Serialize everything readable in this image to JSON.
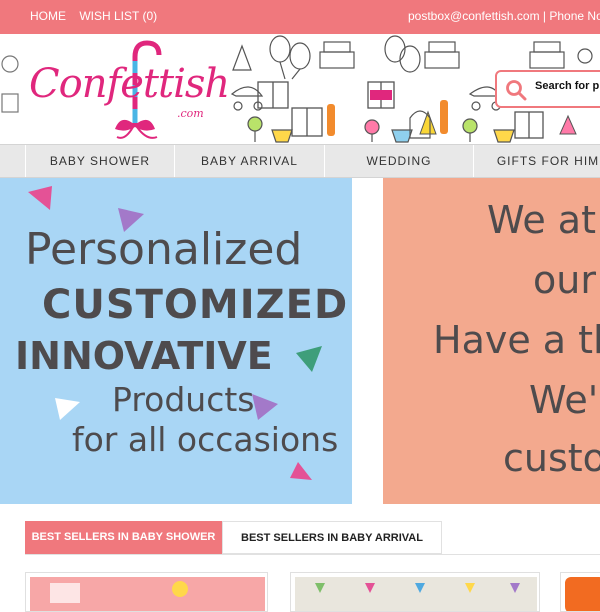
{
  "topbar": {
    "home": "HOME",
    "wishlist": "WISH LIST (0)",
    "contact": "postbox@confettish.com | Phone No"
  },
  "logo": {
    "word": "Confettish",
    "domain": ".com"
  },
  "search": {
    "placeholder": "Search for p"
  },
  "nav": {
    "items": [
      "BABY SHOWER",
      "BABY ARRIVAL",
      "WEDDING",
      "GIFTS FOR HIM"
    ]
  },
  "banner_left": {
    "lines": [
      "Personalized",
      "CUSTOMIZED",
      "INNOVATIVE",
      "Products",
      "for all occasions"
    ]
  },
  "banner_right": {
    "lines": [
      "We at Co",
      "our c",
      "Have a ther",
      "We'll",
      "custom"
    ]
  },
  "tabs": {
    "active": "BEST SELLERS IN BABY SHOWER",
    "inactive": "BEST SELLERS IN BABY ARRIVAL"
  },
  "colors": {
    "accent": "#f0787d",
    "nav_bg": "#e8e8e8",
    "banner_blue": "#a9d6f5",
    "banner_peach": "#f3a98e",
    "logo_pink": "#e0277d"
  }
}
